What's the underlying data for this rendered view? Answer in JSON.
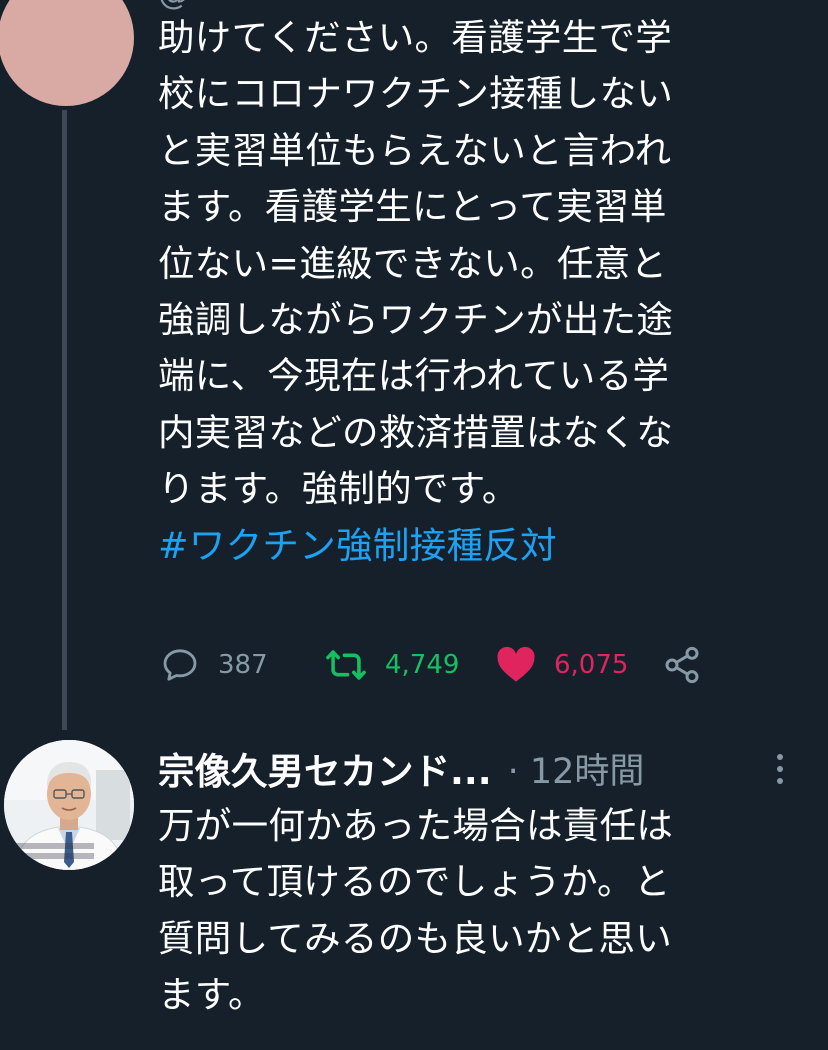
{
  "tweet1": {
    "header_fragment": "@",
    "text_lines": [
      "助けてください。看護学生で学",
      "校にコロナワクチン接種しない",
      "と実習単位もらえないと言われ",
      "ます。看護学生にとって実習単",
      "位ない=進級できない。任意と",
      "強調しながらワクチンが出た途",
      "端に、今現在は行われている学",
      "内実習などの救済措置はなくな",
      "ります。強制的です。"
    ],
    "hashtag": "#ワクチン強制接種反対",
    "actions": {
      "reply_count": "387",
      "retweet_count": "4,749",
      "like_count": "6,075"
    }
  },
  "tweet2": {
    "display_name": "宗像久男セカンド...",
    "time": "· 12時間",
    "text_lines": [
      "万が一何かあった場合は責任は",
      "取って頂けるのでしょうか。と",
      "質問してみるのも良いかと思い",
      "ます。"
    ]
  },
  "colors": {
    "background": "#15202b",
    "text": "#ffffff",
    "muted": "#8899a6",
    "link": "#1da1f2",
    "retweet": "#17bf63",
    "like": "#e0245e"
  },
  "icons": [
    "reply-icon",
    "retweet-icon",
    "heart-icon",
    "share-icon",
    "more-vertical-icon"
  ]
}
